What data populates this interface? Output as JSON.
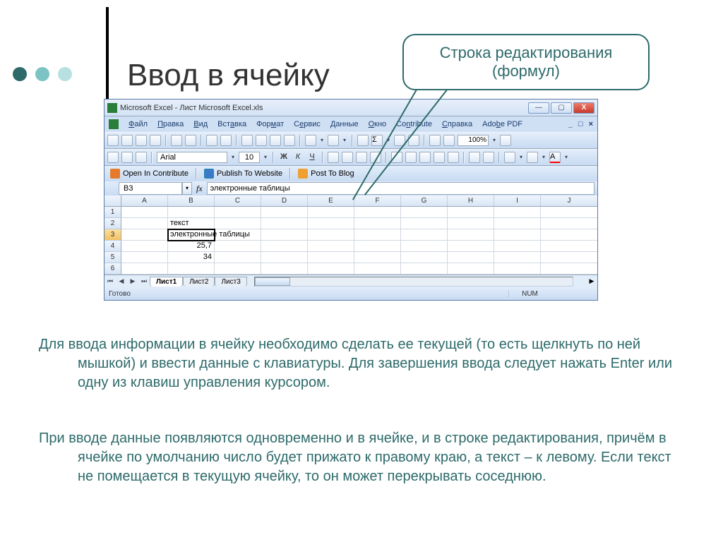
{
  "slide": {
    "title": "Ввод в ячейку",
    "callout": "Строка редактирования (формул)",
    "para1": "Для ввода информации в ячейку необходимо сделать ее текущей (то есть щелкнуть по ней мышкой)  и ввести данные с клавиатуры. Для завершения ввода следует нажать Enter или одну из клавиш управления курсором.",
    "para2": "При вводе данные появляются одновременно и в ячейке, и в строке редактирования, причём в ячейке по умолчанию число будет прижато к правому краю, а текст – к левому. Если текст не помещается в текущую ячейку, то он может перекрывать соседнюю."
  },
  "excel": {
    "title": "Microsoft Excel - Лист Microsoft Excel.xls",
    "menu": [
      "Файл",
      "Правка",
      "Вид",
      "Вставка",
      "Формат",
      "Сервис",
      "Данные",
      "Окно",
      "Contribute",
      "Справка",
      "Adobe PDF"
    ],
    "zoom": "100%",
    "font": "Arial",
    "fontsize": "10",
    "formats": {
      "b": "Ж",
      "i": "К",
      "u": "Ч"
    },
    "contribute": {
      "open": "Open In Contribute",
      "publish": "Publish To Website",
      "post": "Post To Blog"
    },
    "namebox": "B3",
    "fx": "fx",
    "formula": "электронные таблицы",
    "columns": [
      "A",
      "B",
      "C",
      "D",
      "E",
      "F",
      "G",
      "H",
      "I",
      "J"
    ],
    "rows": [
      "1",
      "2",
      "3",
      "4",
      "5",
      "6"
    ],
    "cells": {
      "B2": "текст",
      "B3": "электронные таблицы",
      "B4": "25,7",
      "B5": "34"
    },
    "tabs": [
      "Лист1",
      "Лист2",
      "Лист3"
    ],
    "status": {
      "ready": "Готово",
      "num": "NUM"
    }
  }
}
